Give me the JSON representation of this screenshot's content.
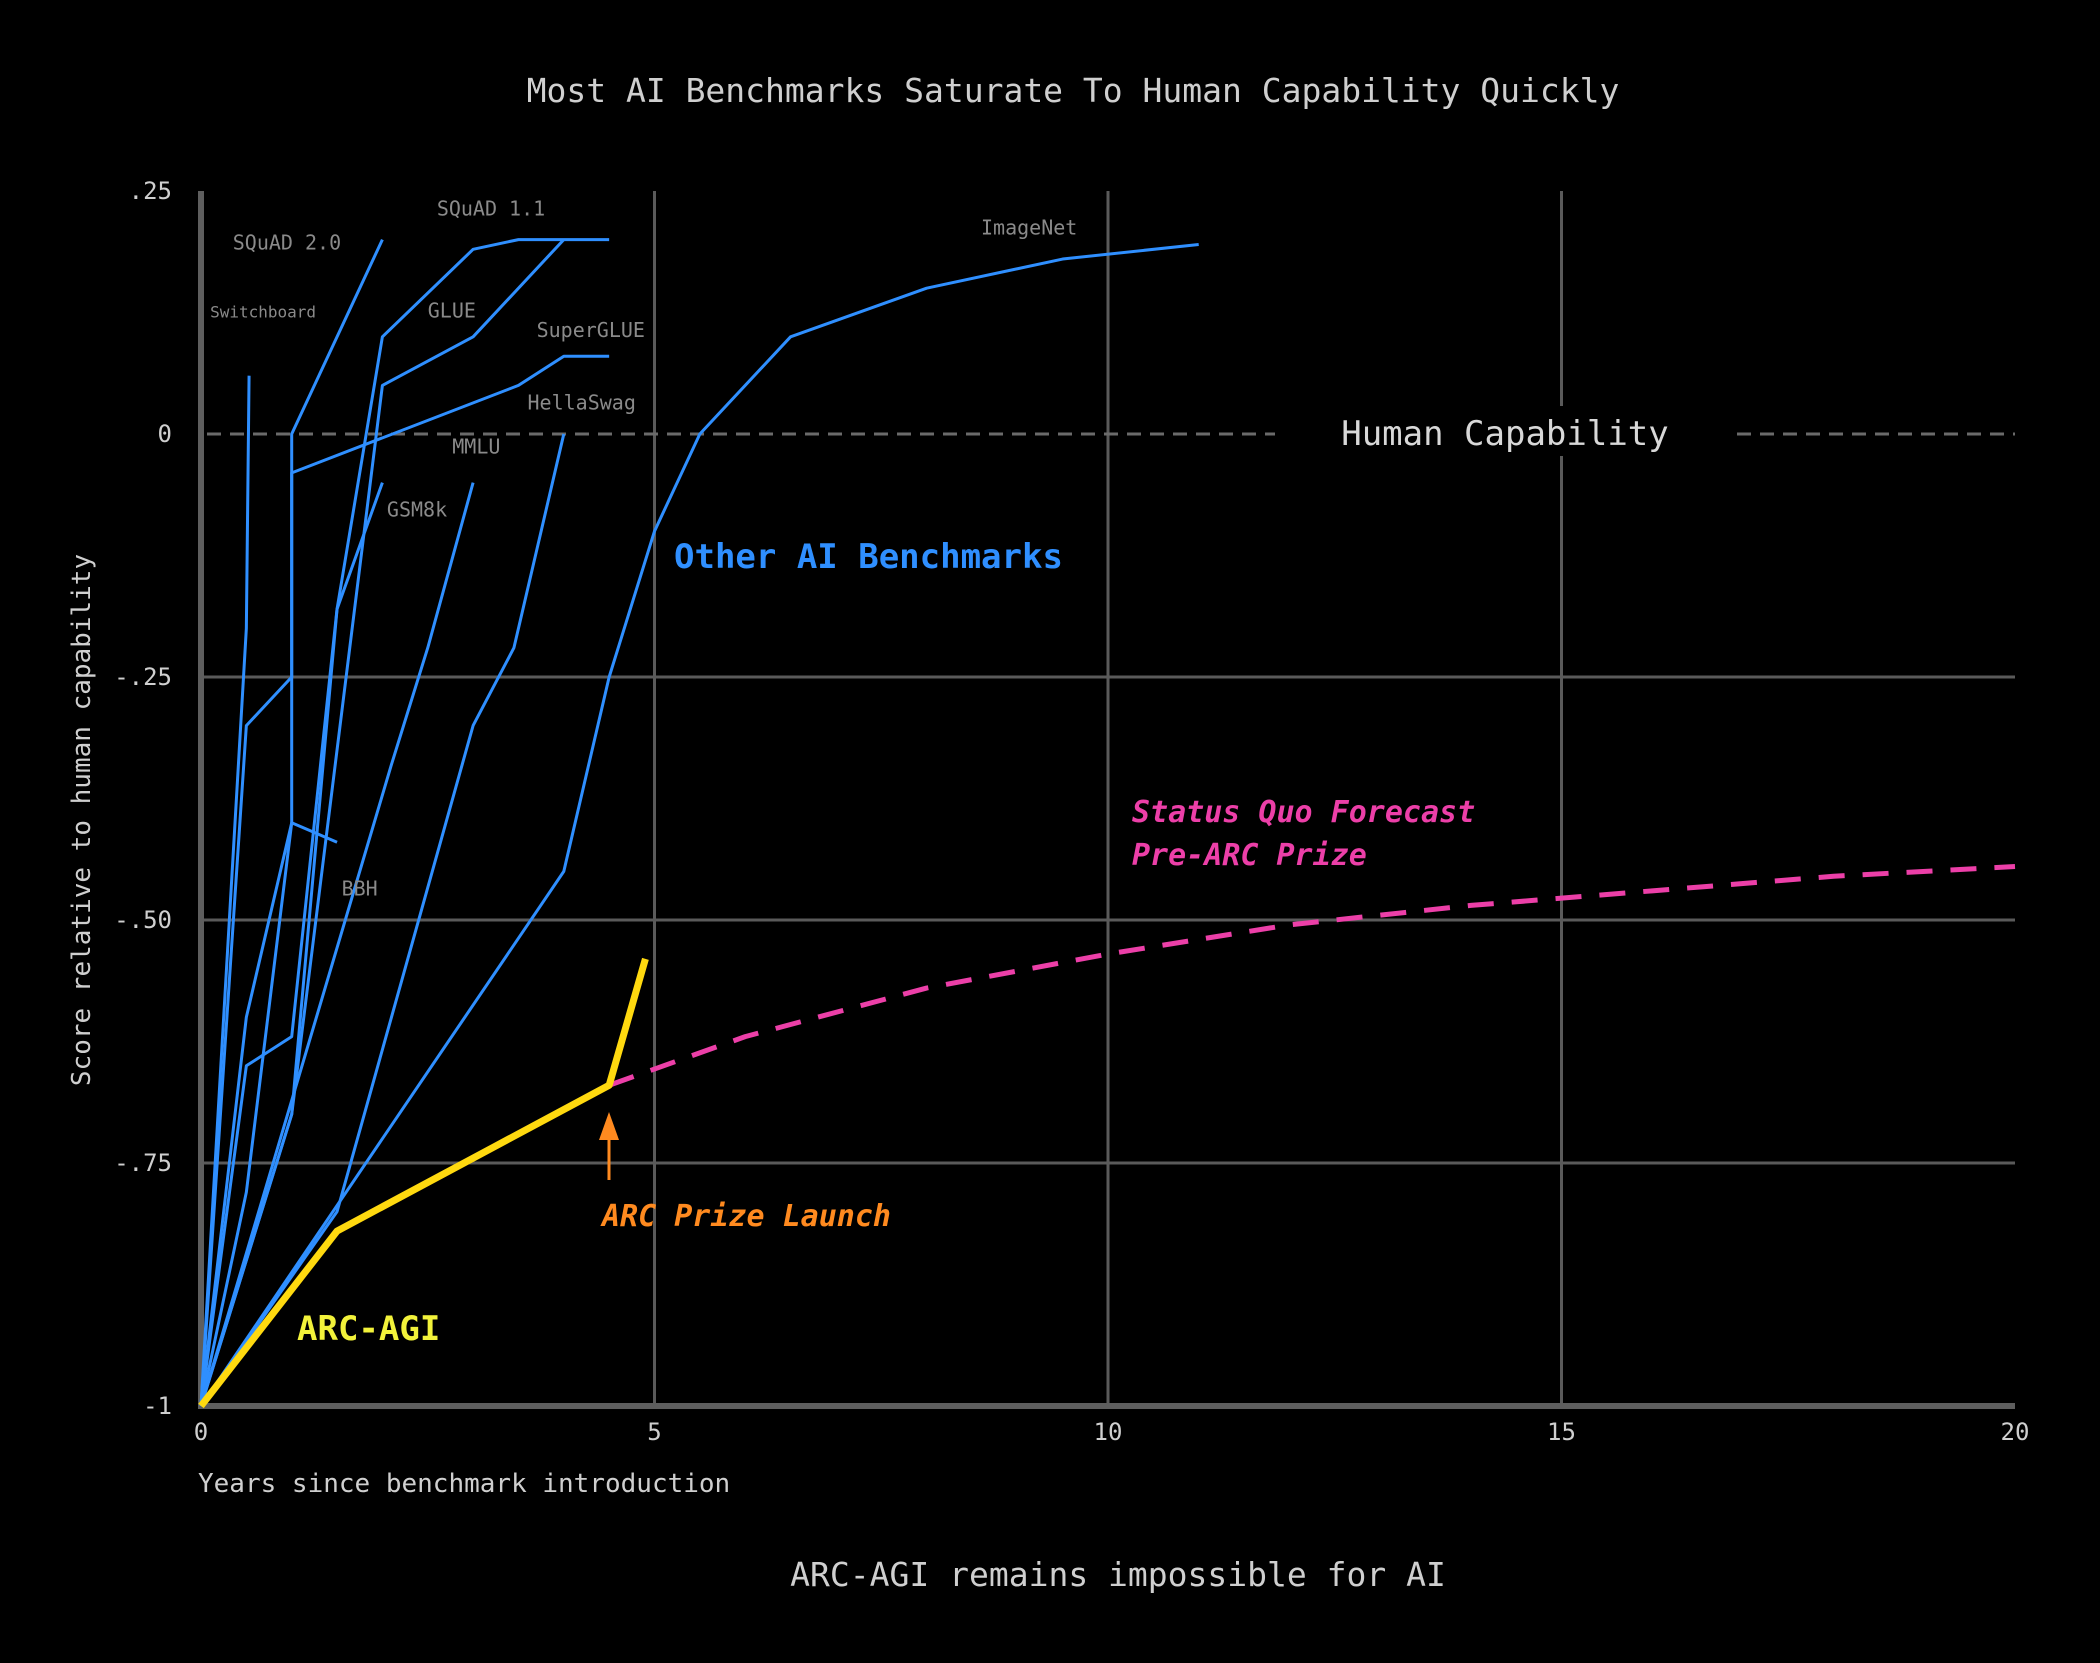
{
  "chart_data": {
    "type": "line",
    "title": "Most AI Benchmarks Saturate To Human Capability Quickly",
    "xlabel": "Years since benchmark introduction",
    "ylabel": "Score relative to human capability",
    "caption": "ARC-AGI remains impossible for AI",
    "xlim": [
      0,
      20
    ],
    "ylim": [
      -1,
      0.25
    ],
    "x_ticks": [
      0,
      5,
      10,
      15,
      20
    ],
    "x_tick_labels": [
      "0",
      "5",
      "10",
      "15",
      "20"
    ],
    "y_ticks": [
      0.25,
      0,
      -0.25,
      -0.5,
      -0.75,
      -1
    ],
    "y_tick_labels": [
      ".25",
      "0",
      "-.25",
      "-.50",
      "-.75",
      "-1"
    ],
    "grid": true,
    "reference_line": {
      "label": "Human Capability",
      "y": 0
    },
    "colors": {
      "benchmarks": "#2f8fff",
      "arc_agi": "#ffd90f",
      "forecast": "#ec3fa8",
      "launch": "#ff8a1f",
      "grid": "#5a5a5a"
    },
    "series": [
      {
        "name": "Switchboard",
        "x": [
          0,
          0.5,
          0.53
        ],
        "y": [
          -1,
          -0.2,
          0.06
        ]
      },
      {
        "name": "SQuAD 2.0",
        "x": [
          0,
          0.5,
          1.0,
          1.0,
          2.0
        ],
        "y": [
          -1,
          -0.3,
          -0.25,
          0.0,
          0.2
        ]
      },
      {
        "name": "SQuAD 1.1",
        "x": [
          0,
          0.5,
          1.0,
          1.5,
          2.0,
          3.0,
          3.5,
          4.5
        ],
        "y": [
          -1,
          -0.65,
          -0.62,
          -0.18,
          0.1,
          0.19,
          0.2,
          0.2
        ]
      },
      {
        "name": "GLUE",
        "x": [
          0,
          1.0,
          2.0,
          3.0,
          4.0
        ],
        "y": [
          -1,
          -0.7,
          0.05,
          0.1,
          0.2
        ]
      },
      {
        "name": "SuperGLUE",
        "x": [
          0,
          0.5,
          1.0,
          1.0,
          3.5,
          4.0,
          4.5
        ],
        "y": [
          -1,
          -0.78,
          -0.4,
          -0.04,
          0.05,
          0.08,
          0.08
        ]
      },
      {
        "name": "HellaSwag",
        "x": [
          0,
          1.5,
          3.0,
          3.45,
          4.0
        ],
        "y": [
          -1,
          -0.8,
          -0.3,
          -0.22,
          0.0
        ]
      },
      {
        "name": "MMLU",
        "x": [
          0,
          2.1,
          2.5,
          3.0
        ],
        "y": [
          -1,
          -0.34,
          -0.22,
          -0.05
        ]
      },
      {
        "name": "GSM8k",
        "x": [
          0,
          1.0,
          1.5,
          2.0
        ],
        "y": [
          -1,
          -0.7,
          -0.18,
          -0.05
        ]
      },
      {
        "name": "BBH",
        "x": [
          0,
          0.5,
          1.0,
          1.5
        ],
        "y": [
          -1,
          -0.6,
          -0.4,
          -0.42
        ]
      },
      {
        "name": "ImageNet",
        "x": [
          0,
          4.0,
          4.5,
          5.0,
          5.5,
          6.5,
          8.0,
          9.5,
          11.0
        ],
        "y": [
          -1,
          -0.45,
          -0.25,
          -0.1,
          0.0,
          0.1,
          0.15,
          0.18,
          0.195
        ]
      },
      {
        "name": "ARC-AGI",
        "x": [
          0,
          1.5,
          4.5,
          4.9
        ],
        "y": [
          -1,
          -0.82,
          -0.67,
          -0.54
        ]
      },
      {
        "name": "Status Quo Forecast Pre-ARC Prize",
        "x": [
          4.5,
          6,
          8,
          10,
          12,
          14,
          16,
          18,
          20
        ],
        "y": [
          -0.67,
          -0.62,
          -0.57,
          -0.535,
          -0.505,
          -0.485,
          -0.47,
          -0.455,
          -0.445
        ]
      }
    ],
    "series_labels": [
      {
        "text": "SQuAD 2.0",
        "x": 0.35,
        "y": 0.19
      },
      {
        "text": "SQuAD 1.1",
        "x": 2.6,
        "y": 0.225
      },
      {
        "text": "Switchboard",
        "x": 0.1,
        "y": 0.12
      },
      {
        "text": "GLUE",
        "x": 2.5,
        "y": 0.12
      },
      {
        "text": "SuperGLUE",
        "x": 3.7,
        "y": 0.1
      },
      {
        "text": "HellaSwag",
        "x": 3.6,
        "y": 0.025
      },
      {
        "text": "MMLU",
        "x": 2.77,
        "y": -0.02
      },
      {
        "text": "GSM8k",
        "x": 2.05,
        "y": -0.085
      },
      {
        "text": "BBH",
        "x": 1.55,
        "y": -0.475
      },
      {
        "text": "ImageNet",
        "x": 8.6,
        "y": 0.205
      }
    ],
    "annotations": {
      "other_benchmarks": "Other AI Benchmarks",
      "arc_agi": "ARC-AGI",
      "forecast_line1": "Status Quo Forecast",
      "forecast_line2": "Pre-ARC Prize",
      "launch": "ARC Prize Launch",
      "launch_x": 4.5
    }
  }
}
